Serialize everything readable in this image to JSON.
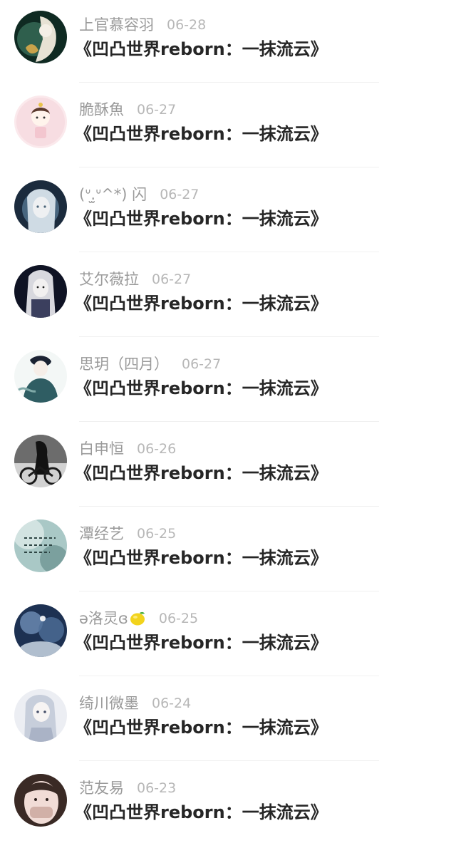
{
  "comments": [
    {
      "name": "上官慕容羽",
      "date": "06-28",
      "title": "《凹凸世界reborn：一抹流云》",
      "avatar_colors": [
        "#0f2a22",
        "#4c8a6e",
        "#e7e2d4"
      ]
    },
    {
      "name": "脆酥魚",
      "date": "06-27",
      "title": "《凹凸世界reborn：一抹流云》",
      "avatar_colors": [
        "#fbe9ec",
        "#f3c6cf",
        "#5b3a2e"
      ]
    },
    {
      "name": "(ᐡ.̫ᐡ^*) 闪",
      "date": "06-27",
      "title": "《凹凸世界reborn：一抹流云》",
      "avatar_colors": [
        "#1b2b3d",
        "#8fb0c8",
        "#eef0f2"
      ]
    },
    {
      "name": "艾尔薇拉",
      "date": "06-27",
      "title": "《凹凸世界reborn：一抹流云》",
      "avatar_colors": [
        "#0f1324",
        "#3b3f5e",
        "#e6e6ea"
      ]
    },
    {
      "name": "思玥（四月）",
      "date": "06-27",
      "title": "《凹凸世界reborn：一抹流云》",
      "avatar_colors": [
        "#f3f7f6",
        "#2f5d63",
        "#1a2232"
      ]
    },
    {
      "name": "白申恒",
      "date": "06-26",
      "title": "《凹凸世界reborn：一抹流云》",
      "avatar_colors": [
        "#121212",
        "#6c6c6c",
        "#d2d2d2"
      ]
    },
    {
      "name": "潭经艺",
      "date": "06-25",
      "title": "《凹凸世界reborn：一抹流云》",
      "avatar_colors": [
        "#a9c8c6",
        "#5e8583",
        "#e4eeec"
      ]
    },
    {
      "name": "ə洛灵ɞ",
      "name_emoji": "lemon-icon",
      "date": "06-25",
      "title": "《凹凸世界reborn：一抹流云》",
      "avatar_colors": [
        "#1d3152",
        "#6f8fb6",
        "#d6e2ee"
      ]
    },
    {
      "name": "绮川微墨",
      "date": "06-24",
      "title": "《凹凸世界reborn：一抹流云》",
      "avatar_colors": [
        "#eceef3",
        "#aab3c6",
        "#47506a"
      ]
    },
    {
      "name": "范友易",
      "date": "06-23",
      "title": "《凹凸世界reborn：一抹流云》",
      "avatar_colors": [
        "#f1dcd6",
        "#c9a59b",
        "#3a2a25"
      ]
    }
  ]
}
